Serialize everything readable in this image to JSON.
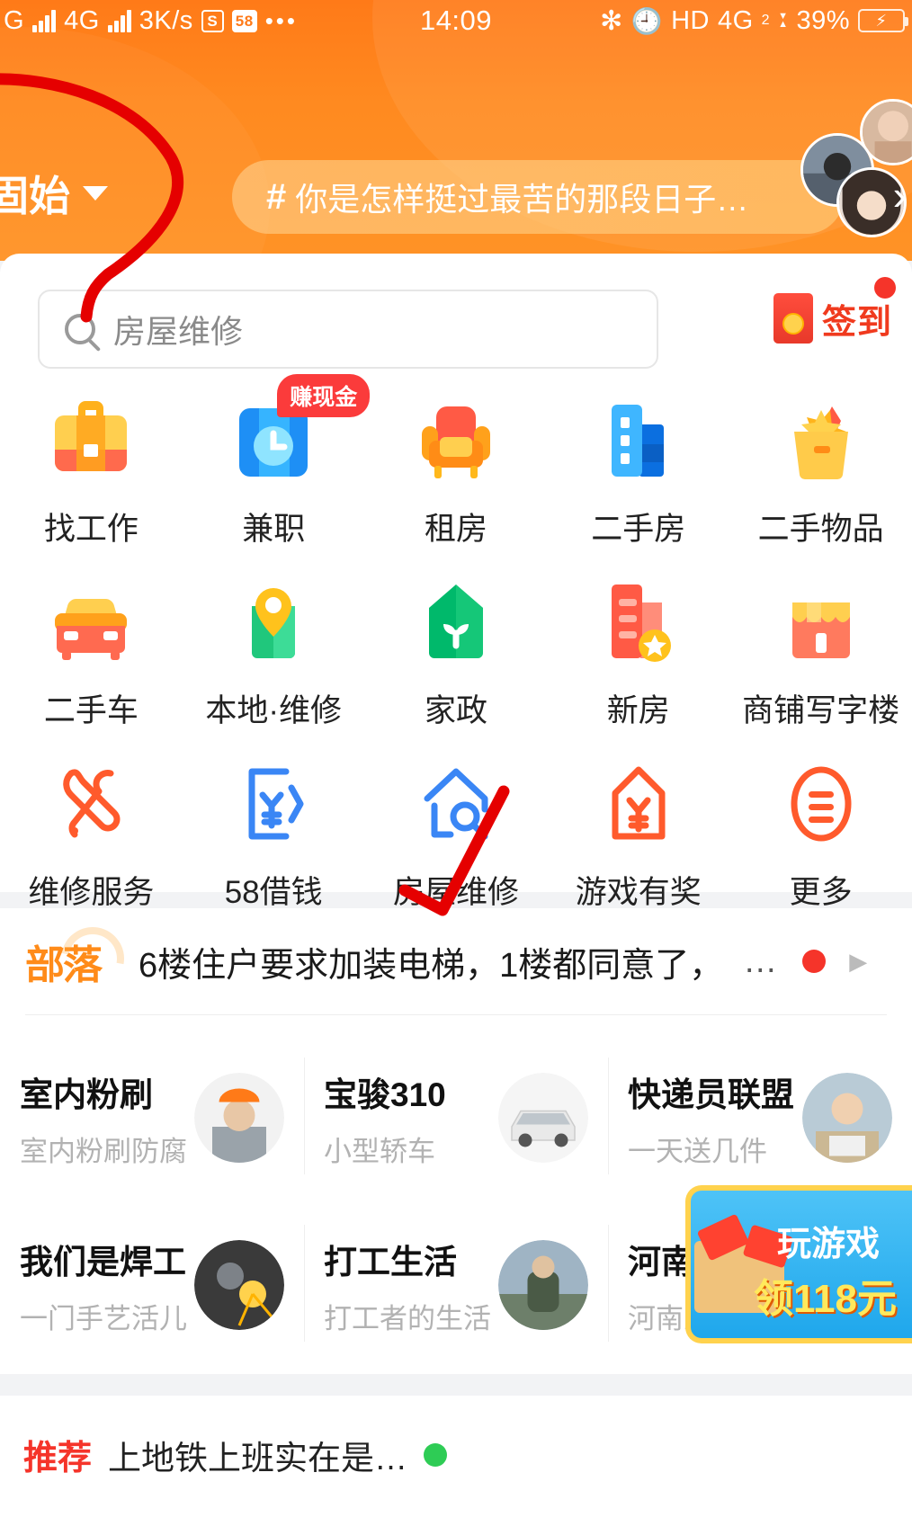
{
  "status_bar": {
    "network_label": "G",
    "network_label2": "4G",
    "speed": "3K/s",
    "badge_s": "S",
    "badge_58": "58",
    "more": "•••",
    "time": "14:09",
    "bluetooth_icon": "bluetooth-icon",
    "alarm_icon": "alarm-icon",
    "hd_label": "HD",
    "sim2_label": "4G",
    "sim2_sub": "2",
    "battery_percent": "39%",
    "charging_icon": "charging-bolt-icon"
  },
  "header": {
    "city": "固始",
    "city_caret_icon": "chevron-down-icon",
    "topic_hash": "#",
    "topic_title": "你是怎样挺过最苦的那段日子…",
    "topic_arrow_icon": "chevron-right-icon",
    "avatars": [
      "avatar-1",
      "avatar-2",
      "avatar-3"
    ]
  },
  "search": {
    "icon": "search-icon",
    "value": "房屋维修",
    "placeholder": "房屋维修"
  },
  "signin": {
    "icon": "red-envelope-icon",
    "label": "签到",
    "has_badge": true
  },
  "grid": {
    "items": [
      {
        "label": "找工作",
        "icon": "briefcase-icon",
        "badge": null
      },
      {
        "label": "兼职",
        "icon": "part-time-clock-icon",
        "badge": "赚现金"
      },
      {
        "label": "租房",
        "icon": "armchair-icon",
        "badge": null
      },
      {
        "label": "二手房",
        "icon": "building-icon",
        "badge": null
      },
      {
        "label": "二手物品",
        "icon": "gift-box-star-icon",
        "badge": null
      },
      {
        "label": "二手车",
        "icon": "car-icon",
        "badge": null
      },
      {
        "label": "本地·维修",
        "icon": "map-pin-icon",
        "badge": null
      },
      {
        "label": "家政",
        "icon": "home-sprout-icon",
        "badge": null
      },
      {
        "label": "新房",
        "icon": "new-building-star-icon",
        "badge": null
      },
      {
        "label": "商铺写字楼",
        "icon": "shop-icon",
        "badge": null
      },
      {
        "label": "维修服务",
        "icon": "wrench-screwdriver-icon",
        "badge": null
      },
      {
        "label": "58借钱",
        "icon": "loan-yuan-icon",
        "badge": null
      },
      {
        "label": "房屋维修",
        "icon": "house-wrench-icon",
        "badge": null
      },
      {
        "label": "游戏有奖",
        "icon": "prize-yuan-icon",
        "badge": null
      },
      {
        "label": "更多",
        "icon": "more-menu-icon",
        "badge": null
      }
    ]
  },
  "tribe": {
    "logo": "部落",
    "headline": "6楼住户要求加装电梯，1楼都同意了，",
    "ellipsis": "…",
    "has_dot": true,
    "arrow_icon": "triangle-right-icon"
  },
  "cards": [
    {
      "title": "室内粉刷",
      "subtitle": "室内粉刷防腐",
      "thumb": "worker-helmet-photo"
    },
    {
      "title": "宝骏310",
      "subtitle": "小型轿车",
      "thumb": "white-car-photo"
    },
    {
      "title": "快递员联盟",
      "subtitle": "一天送几件",
      "thumb": "courier-photo"
    },
    {
      "title": "我们是焊工",
      "subtitle": "一门手艺活儿",
      "thumb": "welder-photo"
    },
    {
      "title": "打工生活",
      "subtitle": "打工者的生活",
      "thumb": "backpacker-photo"
    },
    {
      "title": "河南人",
      "subtitle": "河南人…",
      "thumb": "henan-photo"
    }
  ],
  "ad": {
    "line1": "玩游戏",
    "line2": "领118元",
    "icon": "gift-treasure-icon"
  },
  "bottom": {
    "hot_label": "推荐",
    "text": "上地铁上班实在是…",
    "dot_icon": "green-dot-icon"
  },
  "colors": {
    "brand_orange": "#ff8a20",
    "accent_red": "#f5342a",
    "signin_red": "#f03a1e",
    "annotation_red": "#e50000",
    "label_gray": "#b2b2b2"
  }
}
